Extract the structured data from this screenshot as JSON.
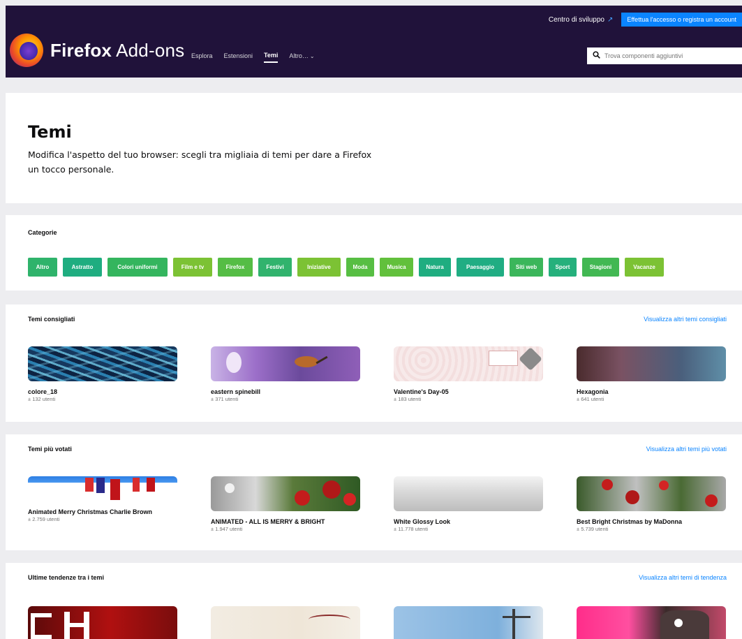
{
  "header": {
    "brand_bold": "Firefox",
    "brand_light": "Add-ons",
    "dev_hub": "Centro di sviluppo",
    "login": "Effettua l'accesso o registra un account",
    "nav": [
      {
        "label": "Esplora"
      },
      {
        "label": "Estensioni"
      },
      {
        "label": "Temi"
      },
      {
        "label": "Altro…"
      }
    ],
    "search": {
      "placeholder": "Trova componenti aggiuntivi",
      "icon": "search-icon"
    }
  },
  "hero": {
    "title": "Temi",
    "description": "Modifica l'aspetto del tuo browser: scegli tra migliaia di temi per dare a Firefox un tocco personale."
  },
  "categories": {
    "title": "Categorie",
    "items": [
      {
        "label": "Altro",
        "color": "#2fb36b"
      },
      {
        "label": "Astratto",
        "color": "#1fad80"
      },
      {
        "label": "Colori uniformi",
        "color": "#34b55e"
      },
      {
        "label": "Film e tv",
        "color": "#7cc234"
      },
      {
        "label": "Firefox",
        "color": "#55bd45"
      },
      {
        "label": "Festivi",
        "color": "#31b36d"
      },
      {
        "label": "Iniziative",
        "color": "#7cc234"
      },
      {
        "label": "Moda",
        "color": "#57be43"
      },
      {
        "label": "Musica",
        "color": "#62c03c"
      },
      {
        "label": "Natura",
        "color": "#1fad80"
      },
      {
        "label": "Paesaggio",
        "color": "#20ad83"
      },
      {
        "label": "Siti web",
        "color": "#3bb65b"
      },
      {
        "label": "Sport",
        "color": "#25b07c"
      },
      {
        "label": "Stagioni",
        "color": "#42b853"
      },
      {
        "label": "Vacanze",
        "color": "#7cc234"
      }
    ]
  },
  "recommended": {
    "title": "Temi consigliati",
    "more": "Visualizza altri temi consigliati",
    "items": [
      {
        "name": "colore_18",
        "users": "± 132 utenti"
      },
      {
        "name": "eastern spinebill",
        "users": "± 371 utenti"
      },
      {
        "name": "Valentine's Day-05",
        "users": "± 183 utenti"
      },
      {
        "name": "Hexagonia",
        "users": "± 641 utenti"
      }
    ]
  },
  "top_rated": {
    "title": "Temi più votati",
    "more": "Visualizza altri temi più votati",
    "items": [
      {
        "name": "Animated Merry Christmas Charlie Brown",
        "users": "± 2.759 utenti"
      },
      {
        "name": "ANIMATED - ALL IS MERRY & BRIGHT",
        "users": "± 1.947 utenti"
      },
      {
        "name": "White Glossy Look",
        "users": "± 11.778 utenti"
      },
      {
        "name": "Best Bright Christmas by MaDonna",
        "users": "± 5.739 utenti"
      }
    ]
  },
  "trending": {
    "title": "Ultime tendenze tra i temi",
    "more": "Visualizza altri temi di tendenza"
  }
}
